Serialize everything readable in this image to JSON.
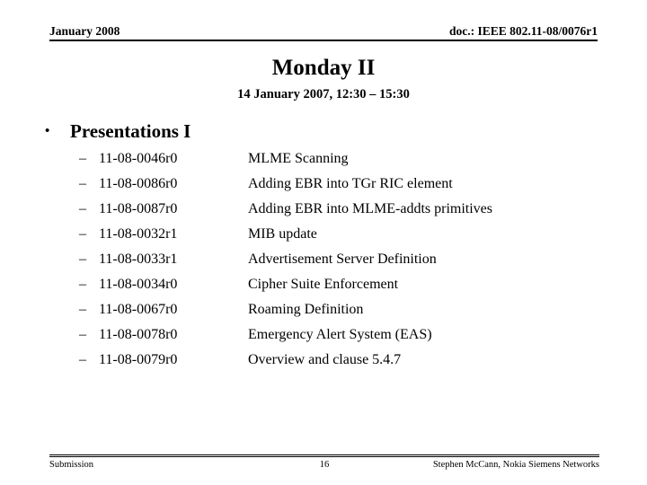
{
  "header": {
    "left": "January 2008",
    "right": "doc.: IEEE 802.11-08/0076r1"
  },
  "title": "Monday II",
  "subtitle": "14 January 2007, 12:30 – 15:30",
  "bullet": {
    "marker": "•",
    "label": "Presentations I"
  },
  "sub_marker": "–",
  "items": [
    {
      "doc": "11-08-0046r0",
      "desc": "MLME Scanning"
    },
    {
      "doc": "11-08-0086r0",
      "desc": "Adding EBR into TGr RIC element"
    },
    {
      "doc": "11-08-0087r0",
      "desc": "Adding EBR into MLME-addts primitives"
    },
    {
      "doc": "11-08-0032r1",
      "desc": "MIB update"
    },
    {
      "doc": "11-08-0033r1",
      "desc": "Advertisement Server Definition"
    },
    {
      "doc": "11-08-0034r0",
      "desc": "Cipher Suite Enforcement"
    },
    {
      "doc": "11-08-0067r0",
      "desc": "Roaming Definition"
    },
    {
      "doc": "11-08-0078r0",
      "desc": "Emergency Alert System (EAS)"
    },
    {
      "doc": "11-08-0079r0",
      "desc": "Overview and clause 5.4.7"
    }
  ],
  "footer": {
    "left": "Submission",
    "page": "16",
    "right": "Stephen McCann, Nokia Siemens Networks"
  }
}
